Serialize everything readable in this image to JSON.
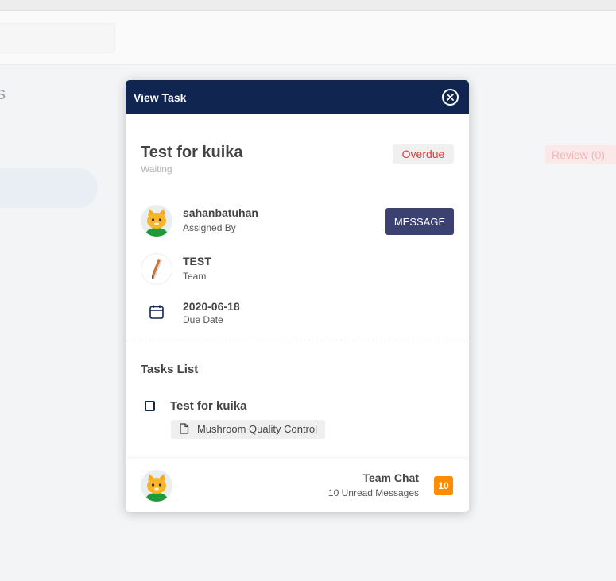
{
  "background": {
    "left_title": "s",
    "review_tab": "Review (0)"
  },
  "modal": {
    "title": "View Task",
    "task": {
      "name": "Test for kuika",
      "status": "Waiting",
      "badge": "Overdue"
    },
    "assigned_by": {
      "name": "sahanbatuhan",
      "label": "Assigned By",
      "button": "MESSAGE"
    },
    "team": {
      "name": "TEST",
      "label": "Team"
    },
    "due": {
      "date": "2020-06-18",
      "label": "Due Date"
    },
    "tasks_list": {
      "heading": "Tasks List",
      "items": [
        {
          "label": "Test for kuika",
          "chip": "Mushroom Quality Control"
        }
      ]
    },
    "team_chat": {
      "title": "Team Chat",
      "subtitle": "10 Unread Messages",
      "unread": "10"
    }
  },
  "colors": {
    "header": "#102650",
    "message_button": "#3b4271",
    "overdue": "#e23b3b",
    "unread_badge": "#ff8c00"
  },
  "icons": [
    "close-icon",
    "avatar-cat-icon",
    "pencil-icon",
    "calendar-icon",
    "checkbox-icon",
    "document-icon"
  ]
}
